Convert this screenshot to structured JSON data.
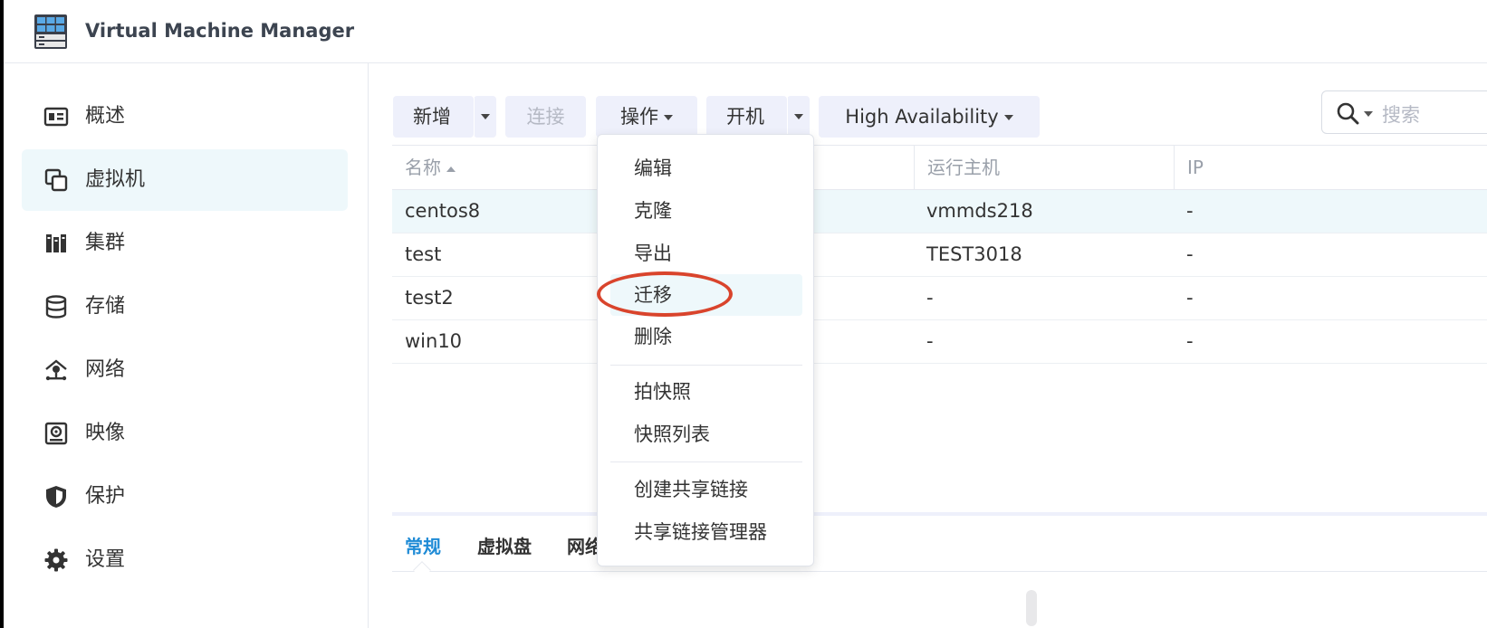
{
  "app": {
    "title": "Virtual Machine Manager"
  },
  "sidebar": {
    "items": [
      {
        "label": "概述",
        "icon": "overview-icon"
      },
      {
        "label": "虚拟机",
        "icon": "virtual-machine-icon",
        "active": true
      },
      {
        "label": "集群",
        "icon": "cluster-icon"
      },
      {
        "label": "存储",
        "icon": "storage-icon"
      },
      {
        "label": "网络",
        "icon": "network-icon"
      },
      {
        "label": "映像",
        "icon": "image-icon"
      },
      {
        "label": "保护",
        "icon": "shield-icon"
      },
      {
        "label": "设置",
        "icon": "gear-icon"
      }
    ]
  },
  "toolbar": {
    "add_label": "新增",
    "connect_label": "连接",
    "action_label": "操作",
    "power_on_label": "开机",
    "ha_label": "High Availability"
  },
  "search": {
    "placeholder": "搜索"
  },
  "table": {
    "columns": [
      "名称",
      "运行主机",
      "IP"
    ],
    "rows": [
      {
        "name": "centos8",
        "host": "vmmds218",
        "ip": "-"
      },
      {
        "name": "test",
        "host": "TEST3018",
        "ip": "-"
      },
      {
        "name": "test2",
        "host": "-",
        "ip": "-"
      },
      {
        "name": "win10",
        "host": "-",
        "ip": "-"
      }
    ]
  },
  "detail_tabs": [
    "常规",
    "虚拟盘",
    "网络"
  ],
  "dropdown": {
    "items": [
      "编辑",
      "克隆",
      "导出",
      "迁移",
      "删除",
      "拍快照",
      "快照列表",
      "创建共享链接",
      "共享链接管理器"
    ],
    "highlighted": "迁移"
  },
  "colors": {
    "accent": "#1f8bd6",
    "annotation": "#d9442c",
    "selected_row": "#eef8fb",
    "button_bg": "#eef0fb"
  }
}
